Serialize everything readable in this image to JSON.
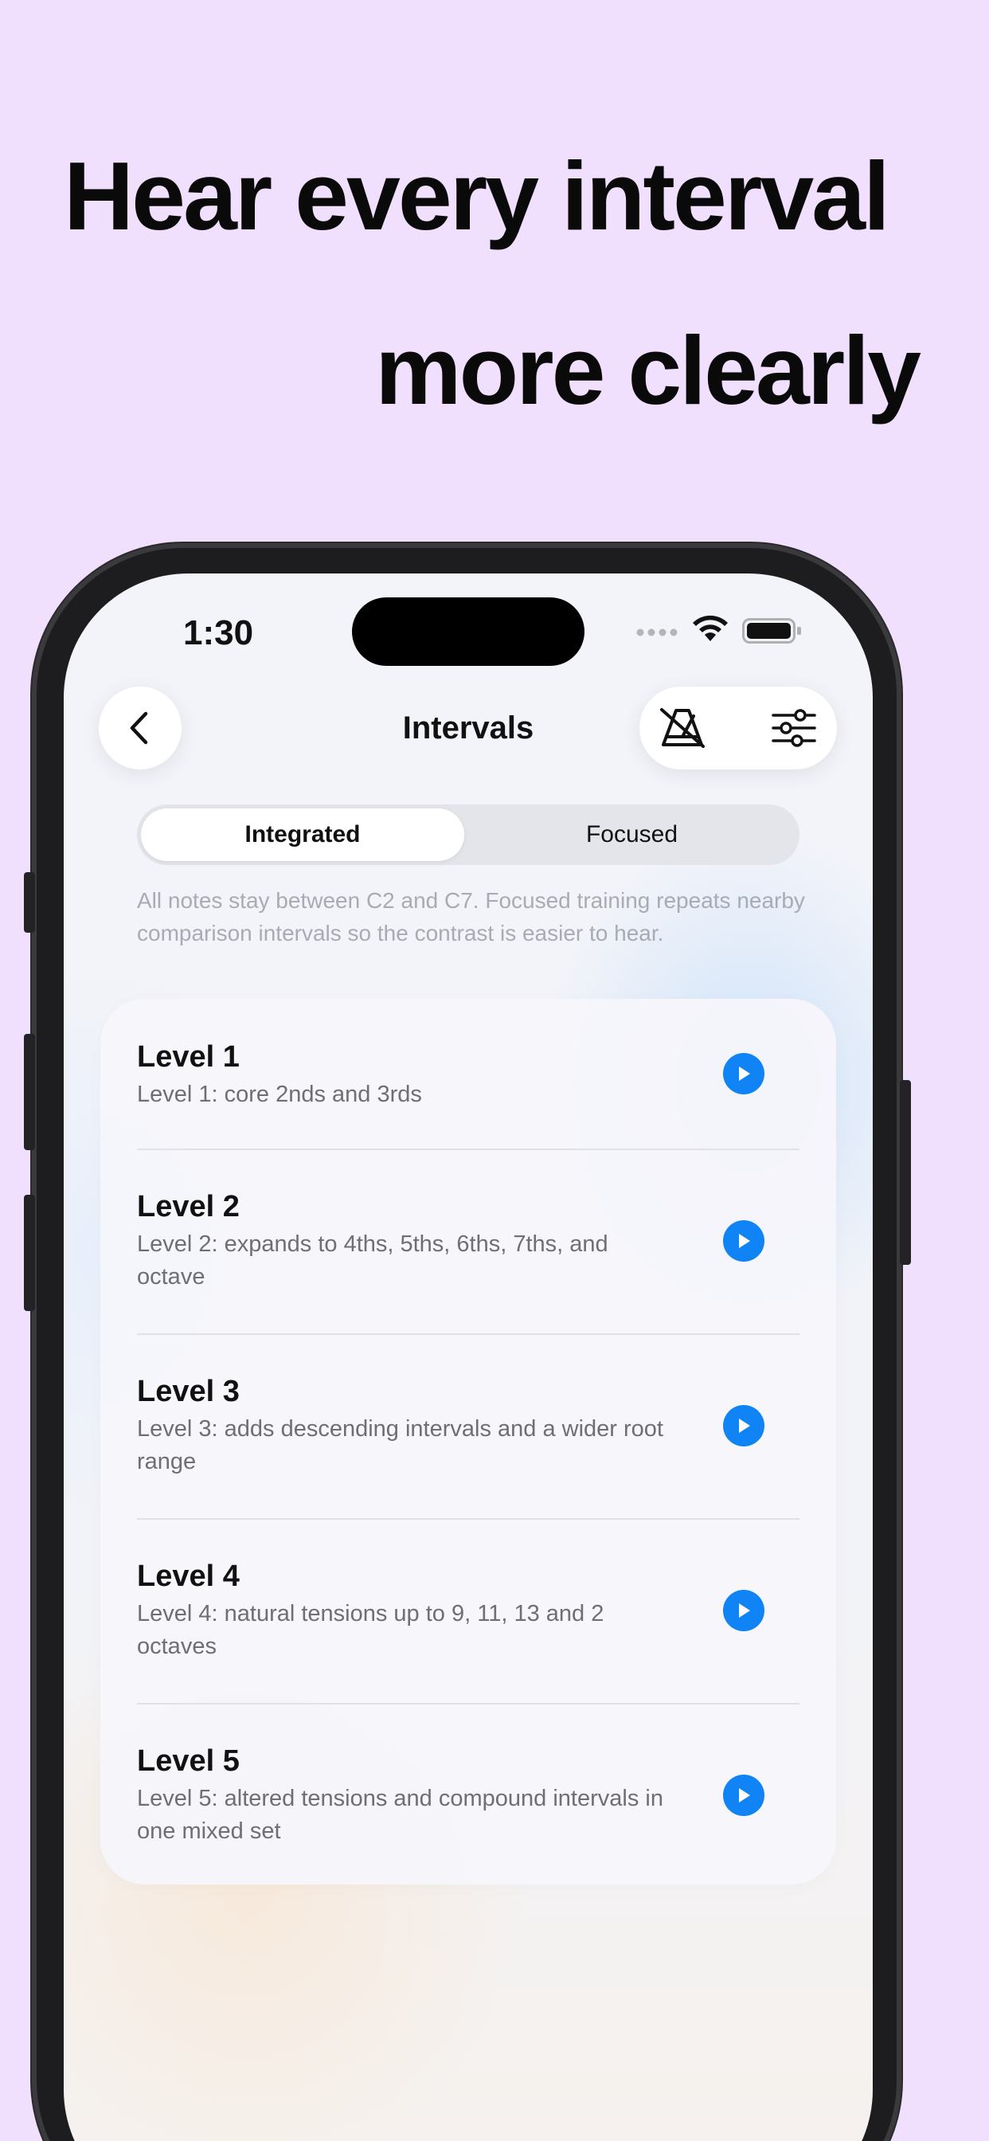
{
  "headline": {
    "line1": "Hear every interval",
    "line2": "more clearly"
  },
  "status_bar": {
    "time": "1:30"
  },
  "nav": {
    "title": "Intervals",
    "icons": [
      "chevron-left-icon",
      "metronome-icon",
      "sliders-icon"
    ]
  },
  "segmented": {
    "options": [
      "Integrated",
      "Focused"
    ],
    "selected": "Integrated"
  },
  "description": "All notes stay between C2 and C7. Focused training repeats nearby comparison intervals so the contrast is easier to hear.",
  "levels": [
    {
      "title": "Level 1",
      "desc": "Level 1: core 2nds and 3rds"
    },
    {
      "title": "Level 2",
      "desc": "Level 2: expands to 4ths, 5ths, 6ths, 7ths, and octave"
    },
    {
      "title": "Level 3",
      "desc": "Level 3: adds descending intervals and a wider root range"
    },
    {
      "title": "Level 4",
      "desc": "Level 4: natural tensions up to 9, 11, 13 and 2 octaves"
    },
    {
      "title": "Level 5",
      "desc": "Level 5: altered tensions and compound intervals in one mixed set"
    }
  ],
  "colors": {
    "background": "#f0dffd",
    "accent": "#1184f5"
  }
}
